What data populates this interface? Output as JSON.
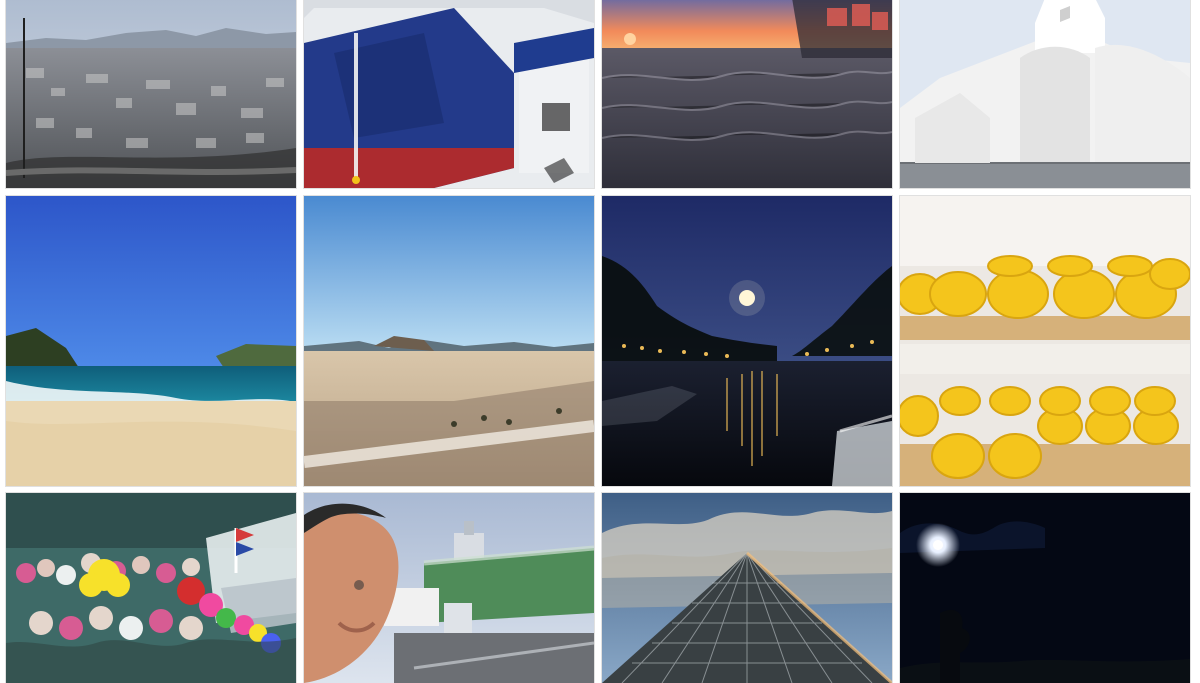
{
  "gallery": {
    "tiles": [
      {
        "id": "athens-city-view",
        "colors": {
          "sky": "#b9c7d8",
          "ground": "#7c8088"
        }
      },
      {
        "id": "blue-ferry-stern",
        "colors": {
          "hull": "#243a88",
          "band": "#b42a2a",
          "sky": "#d9dde2"
        }
      },
      {
        "id": "sunset-sea",
        "colors": {
          "sky": "#f28a5a",
          "sea": "#3e3e4b"
        }
      },
      {
        "id": "white-church",
        "colors": {
          "sky": "#dfe7f2",
          "walls": "#f2f2f2"
        }
      },
      {
        "id": "beach-blue-sky",
        "colors": {
          "sky": "#2e6cd3",
          "sea": "#0e6d8b",
          "sand": "#ead8b4"
        }
      },
      {
        "id": "sand-plateau-sea",
        "colors": {
          "sky": "#8ec4ea",
          "sand": "#d8c1a0"
        }
      },
      {
        "id": "canal-at-night",
        "colors": {
          "sky": "#1d2a63",
          "water": "#0e1320",
          "lights": "#f6c35a"
        }
      },
      {
        "id": "cheese-wheels",
        "colors": {
          "cheese": "#f4c51c",
          "shelf": "#d6b17a",
          "wall": "#ece8e3"
        }
      },
      {
        "id": "pride-parade-crowd",
        "colors": {
          "bg": "#3e6a67",
          "balloon": "#f04aa0"
        }
      },
      {
        "id": "selfie-airport",
        "colors": {
          "sky": "#c9d5e6",
          "terminal": "#4f8c59",
          "skin": "#d89a78"
        }
      },
      {
        "id": "glass-pyramid",
        "colors": {
          "sky": "#6b8bb0",
          "cloud": "#d9d2c3",
          "pyramid": "#394043"
        }
      },
      {
        "id": "night-sky-moon",
        "colors": {
          "sky": "#040814",
          "moon": "#e8f0ff"
        }
      }
    ]
  }
}
